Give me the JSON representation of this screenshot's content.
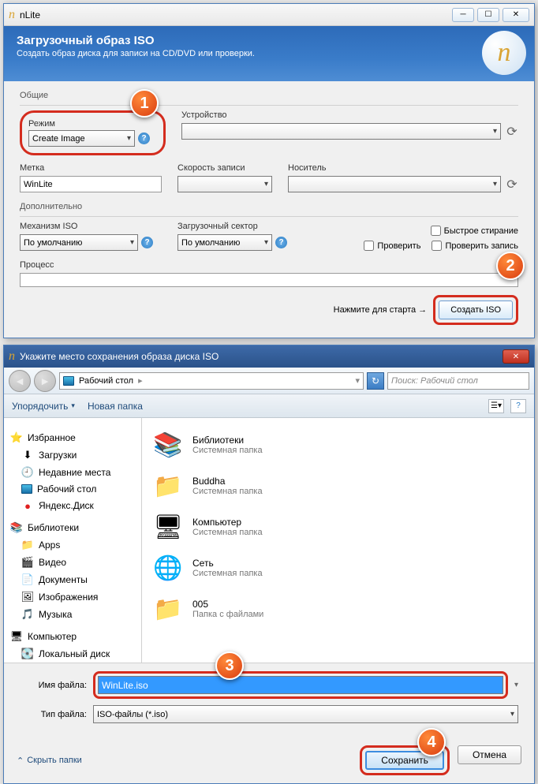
{
  "nlite": {
    "app_name": "nLite",
    "banner_title": "Загрузочный образ ISO",
    "banner_sub": "Создать образ диска для записи на CD/DVD или проверки.",
    "section_general": "Общие",
    "mode_label": "Режим",
    "mode_value": "Create Image",
    "device_label": "Устройство",
    "label_label": "Метка",
    "label_value": "WinLite",
    "speed_label": "Скорость записи",
    "media_label": "Носитель",
    "section_advanced": "Дополнительно",
    "iso_engine_label": "Механизм ISO",
    "iso_engine_value": "По умолчанию",
    "boot_sector_label": "Загрузочный сектор",
    "boot_sector_value": "По умолчанию",
    "quick_erase": "Быстрое стирание",
    "verify": "Проверить",
    "verify_write": "Проверить запись",
    "process_label": "Процесс",
    "start_hint": "Нажмите для старта →",
    "create_iso_btn": "Создать ISO"
  },
  "dialog": {
    "title": "Укажите место сохранения образа диска ISO",
    "location": "Рабочий стол",
    "search_placeholder": "Поиск: Рабочий стол",
    "organize": "Упорядочить",
    "new_folder": "Новая папка",
    "tree": {
      "favorites": "Избранное",
      "downloads": "Загрузки",
      "recent": "Недавние места",
      "desktop": "Рабочий стол",
      "yandex": "Яндекс.Диск",
      "libraries": "Библиотеки",
      "apps": "Apps",
      "video": "Видео",
      "documents": "Документы",
      "pictures": "Изображения",
      "music": "Музыка",
      "computer": "Компьютер",
      "local_disk": "Локальный диск"
    },
    "items": [
      {
        "name": "Библиотеки",
        "sub": "Системная папка"
      },
      {
        "name": "Buddha",
        "sub": "Системная папка"
      },
      {
        "name": "Компьютер",
        "sub": "Системная папка"
      },
      {
        "name": "Сеть",
        "sub": "Системная папка"
      },
      {
        "name": "005",
        "sub": "Папка с файлами"
      }
    ],
    "filename_label": "Имя файла:",
    "filename_value": "WinLite.iso",
    "filetype_label": "Тип файла:",
    "filetype_value": "ISO-файлы (*.iso)",
    "hide_folders": "Скрыть папки",
    "save_btn": "Сохранить",
    "cancel_btn": "Отмена"
  },
  "callouts": {
    "c1": "1",
    "c2": "2",
    "c3": "3",
    "c4": "4"
  }
}
